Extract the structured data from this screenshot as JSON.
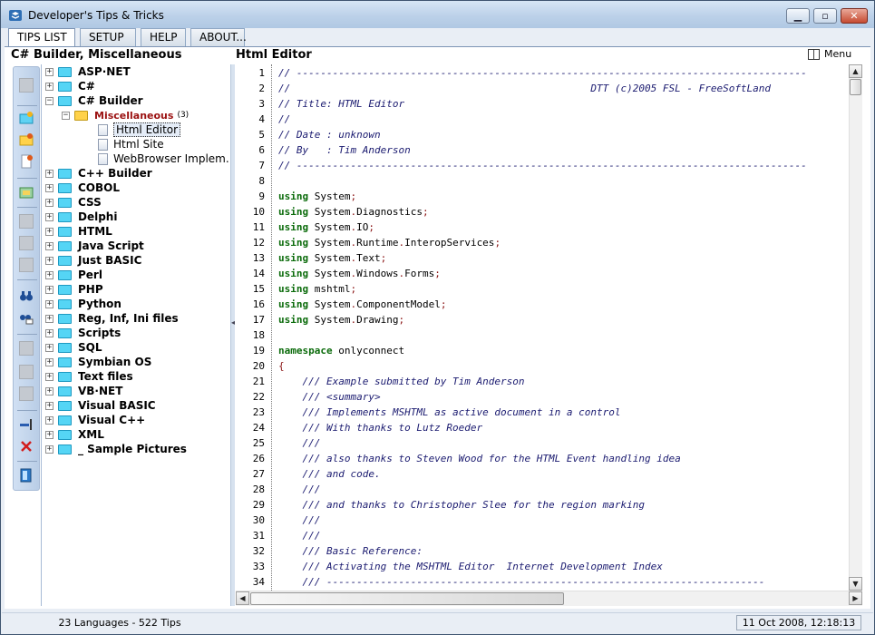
{
  "window": {
    "title": "Developer's Tips & Tricks",
    "minimize_glyph": "▁",
    "maximize_glyph": "▫",
    "close_glyph": "✕"
  },
  "tabs": [
    {
      "label": "TIPS LIST",
      "active": true
    },
    {
      "label": "SETUP",
      "active": false
    },
    {
      "label": "HELP",
      "active": false
    },
    {
      "label": "ABOUT...",
      "active": false
    }
  ],
  "left_panel": {
    "title": "C# Builder, Miscellaneous"
  },
  "editor_panel": {
    "title": "Html Editor",
    "menu_label": "Menu"
  },
  "tree": {
    "expand_glyph": "+",
    "collapse_glyph": "−",
    "items": [
      {
        "label": "ASP·NET"
      },
      {
        "label": "C#"
      },
      {
        "label": "C# Builder"
      },
      {
        "label": "Miscellaneous",
        "count": "(3)"
      },
      {
        "label": "Html Editor"
      },
      {
        "label": "Html Site"
      },
      {
        "label": "WebBrowser Implem..."
      },
      {
        "label": "C++ Builder"
      },
      {
        "label": "COBOL"
      },
      {
        "label": "CSS"
      },
      {
        "label": "Delphi"
      },
      {
        "label": "HTML"
      },
      {
        "label": "Java Script"
      },
      {
        "label": "Just BASIC"
      },
      {
        "label": "Perl"
      },
      {
        "label": "PHP"
      },
      {
        "label": "Python"
      },
      {
        "label": "Reg, Inf, Ini files"
      },
      {
        "label": "Scripts"
      },
      {
        "label": "SQL"
      },
      {
        "label": "Symbian OS"
      },
      {
        "label": "Text files"
      },
      {
        "label": "VB·NET"
      },
      {
        "label": "Visual BASIC"
      },
      {
        "label": "Visual C++"
      },
      {
        "label": "XML"
      },
      {
        "label": "_ Sample Pictures"
      }
    ]
  },
  "code": {
    "line_numbers": [
      "1",
      "2",
      "3",
      "4",
      "5",
      "6",
      "7",
      "8",
      "9",
      "10",
      "11",
      "12",
      "13",
      "14",
      "15",
      "16",
      "17",
      "18",
      "19",
      "20",
      "21",
      "22",
      "23",
      "24",
      "25",
      "26",
      "27",
      "28",
      "29",
      "30",
      "31",
      "32",
      "33",
      "34"
    ],
    "lines": [
      "// -------------------------------------------------------------------------------------",
      "//                                                  DTT (c)2005 FSL - FreeSoftLand",
      "// Title: HTML Editor",
      "//",
      "// Date : unknown",
      "// By   : Tim Anderson",
      "// -------------------------------------------------------------------------------------",
      "",
      "using System;",
      "using System.Diagnostics;",
      "using System.IO;",
      "using System.Runtime.InteropServices;",
      "using System.Text;",
      "using System.Windows.Forms;",
      "using mshtml;",
      "using System.ComponentModel;",
      "using System.Drawing;",
      "",
      "namespace onlyconnect",
      "{",
      "    /// Example submitted by Tim Anderson",
      "    /// <summary>",
      "    /// Implements MSHTML as active document in a control",
      "    /// With thanks to Lutz Roeder",
      "    ///",
      "    /// also thanks to Steven Wood for the HTML Event handling idea",
      "    /// and code.",
      "    ///",
      "    /// and thanks to Christopher Slee for the region marking",
      "    ///",
      "    ///",
      "    /// Basic Reference:",
      "    /// Activating the MSHTML Editor  Internet Development Index",
      "    /// -------------------------------------------------------------------------"
    ]
  },
  "status": {
    "summary": "23 Languages - 522 Tips",
    "datetime": "11 Oct 2008, 12:18:13"
  },
  "colors": {
    "keyword": "#0b6b0b",
    "comment": "#1b1b70",
    "punctuation": "#8b1515",
    "folder": "#55d5f5",
    "open_folder": "#ffd24a",
    "category_highlight": "#9b1111"
  }
}
